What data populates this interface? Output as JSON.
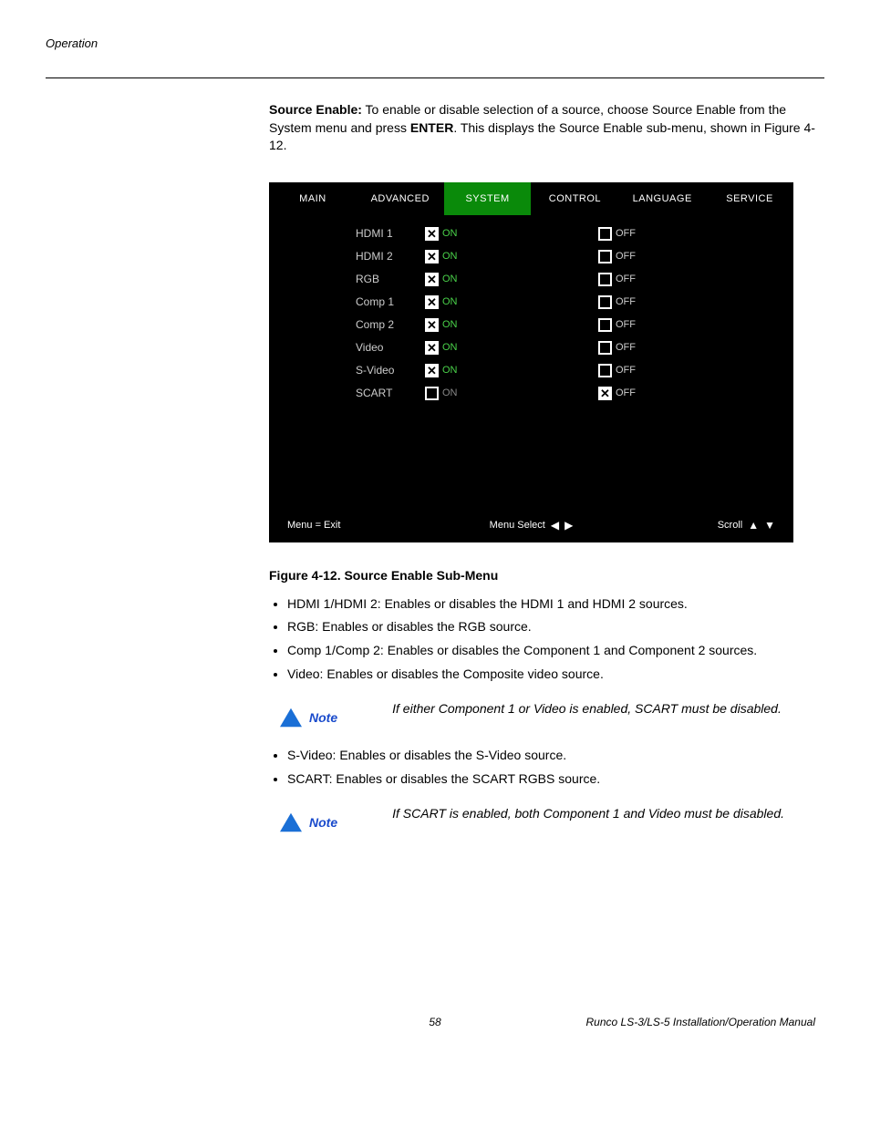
{
  "header": {
    "section": "Operation"
  },
  "intro": {
    "lead_bold": "Source Enable:",
    "lead_rest": " To enable or disable selection of a source, choose Source Enable from the System menu and press ",
    "enter_bold": "ENTER",
    "trail": ". This displays the Source Enable sub-menu, shown in Figure 4-12."
  },
  "osd": {
    "tabs": [
      "MAIN",
      "ADVANCED",
      "SYSTEM",
      "CONTROL",
      "LANGUAGE",
      "SERVICE"
    ],
    "active_tab": 2,
    "rows": [
      {
        "label": "HDMI 1",
        "on_checked": true,
        "off_checked": false
      },
      {
        "label": "HDMI 2",
        "on_checked": true,
        "off_checked": false
      },
      {
        "label": "RGB",
        "on_checked": true,
        "off_checked": false
      },
      {
        "label": "Comp 1",
        "on_checked": true,
        "off_checked": false
      },
      {
        "label": "Comp 2",
        "on_checked": true,
        "off_checked": false
      },
      {
        "label": "Video",
        "on_checked": true,
        "off_checked": false
      },
      {
        "label": "S-Video",
        "on_checked": true,
        "off_checked": false
      },
      {
        "label": "SCART",
        "on_checked": false,
        "off_checked": true
      }
    ],
    "on_text": "ON",
    "off_text": "OFF",
    "footer": {
      "left": "Menu = Exit",
      "mid": "Menu Select",
      "right": "Scroll"
    }
  },
  "figure_caption": "Figure 4-12. Source Enable Sub-Menu",
  "bullets1": [
    "HDMI 1/HDMI 2: Enables or disables the HDMI 1 and HDMI 2 sources.",
    "RGB: Enables or disables the RGB source.",
    "Comp 1/Comp 2: Enables or disables the Component 1 and Component 2 sources.",
    "Video: Enables or disables the Composite video source."
  ],
  "note1": {
    "label": "Note",
    "text": "If either Component 1 or Video is enabled, SCART must be disabled."
  },
  "bullets2": [
    "S-Video: Enables or disables the S-Video source.",
    "SCART: Enables or disables the SCART RGBS source."
  ],
  "note2": {
    "label": "Note",
    "text": "If SCART is enabled, both Component 1 and Video must be disabled."
  },
  "footer": {
    "page": "58",
    "manual": "Runco LS-3/LS-5 Installation/Operation Manual"
  }
}
